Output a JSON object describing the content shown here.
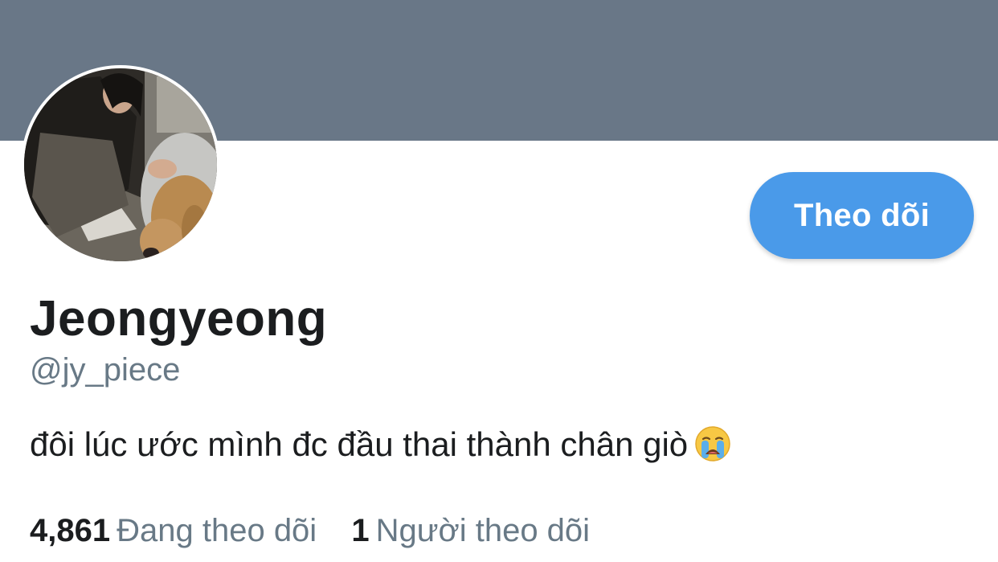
{
  "profile": {
    "display_name": "Jeongyeong",
    "handle": "@jy_piece",
    "bio": "đôi lúc ước mình đc đầu thai thành chân giò",
    "bio_emoji": "crying-face-emoji"
  },
  "actions": {
    "follow_label": "Theo dõi"
  },
  "stats": {
    "following_count": "4,861",
    "following_label": "Đang theo dõi",
    "followers_count": "1",
    "followers_label": "Người theo dõi"
  },
  "colors": {
    "banner": "#697787",
    "accent": "#4a9ae9",
    "secondary_text": "#687986",
    "primary_text": "#1b1d1f"
  }
}
